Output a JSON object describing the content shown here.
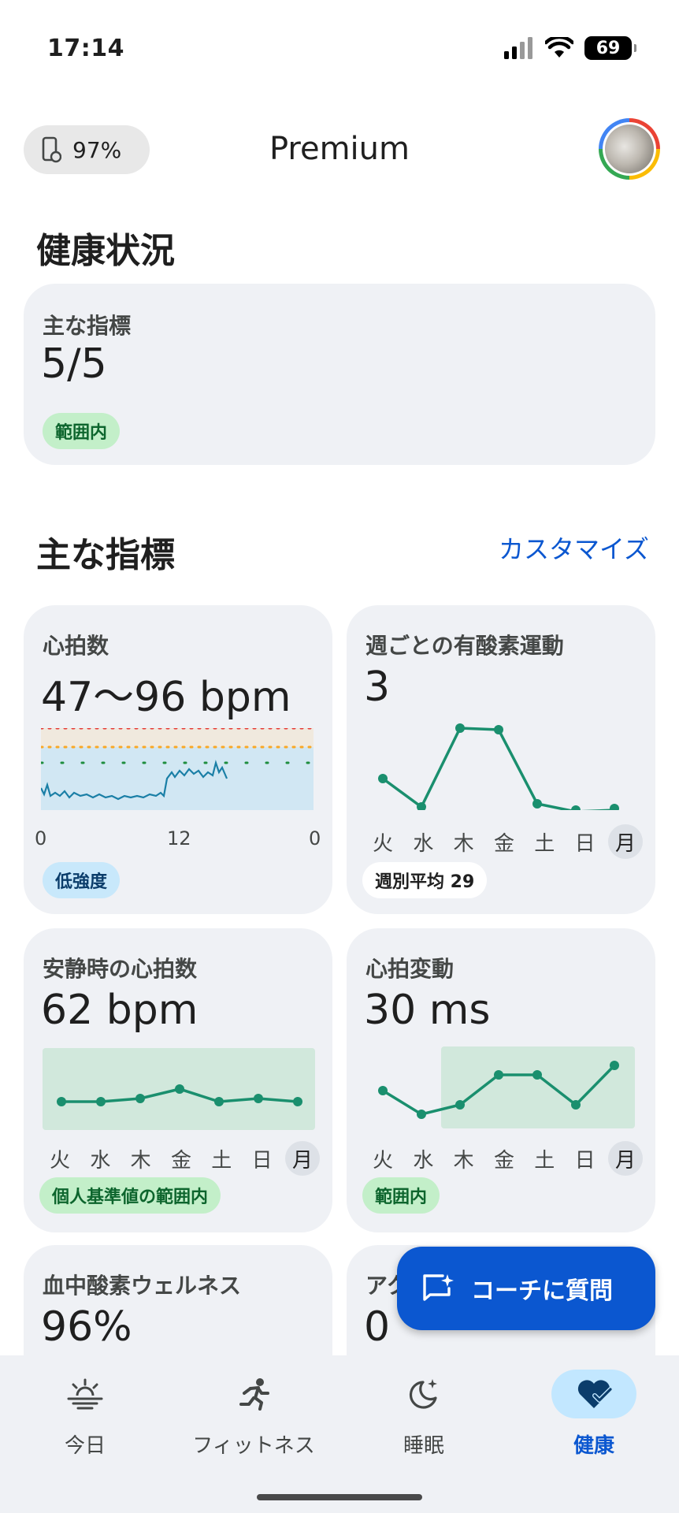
{
  "status_bar": {
    "time": "17:14",
    "battery": "69"
  },
  "header": {
    "battery_label": "97%",
    "title": "Premium"
  },
  "health_status": {
    "section_title": "健康状況",
    "card_label": "主な指標",
    "card_value": "5/5",
    "chip": "範囲内"
  },
  "key_metrics": {
    "section_title": "主な指標",
    "customize_label": "カスタマイズ",
    "heart_rate": {
      "label": "心拍数",
      "value": "47〜96 bpm",
      "axis_ticks": [
        "0",
        "12",
        "0"
      ],
      "chip": "低強度",
      "zone_colors": [
        "#e53935",
        "#f9a825",
        "#1e8e3e"
      ]
    },
    "cardio": {
      "label": "週ごとの有酸素運動",
      "value": "3",
      "days": [
        "火",
        "水",
        "木",
        "金",
        "土",
        "日",
        "月"
      ],
      "chip": "週別平均 29"
    },
    "resting_hr": {
      "label": "安静時の心拍数",
      "value": "62 bpm",
      "days": [
        "火",
        "水",
        "木",
        "金",
        "土",
        "日",
        "月"
      ],
      "chip": "個人基準値の範囲内"
    },
    "hrv": {
      "label": "心拍変動",
      "value": "30 ms",
      "days": [
        "火",
        "水",
        "木",
        "金",
        "土",
        "日",
        "月"
      ],
      "chip": "範囲内"
    },
    "spo2": {
      "label": "血中酸素ウェルネス",
      "value": "96%"
    },
    "partial": {
      "label": "アク",
      "value": "0"
    }
  },
  "fab": {
    "label": "コーチに質問"
  },
  "nav": {
    "today": "今日",
    "fitness": "フィットネス",
    "sleep": "睡眠",
    "health": "健康"
  },
  "colors": {
    "accent": "#0b57d0",
    "line": "#1a8f6e",
    "card_bg": "#eff1f5",
    "in_range": "#c3efc9"
  }
}
